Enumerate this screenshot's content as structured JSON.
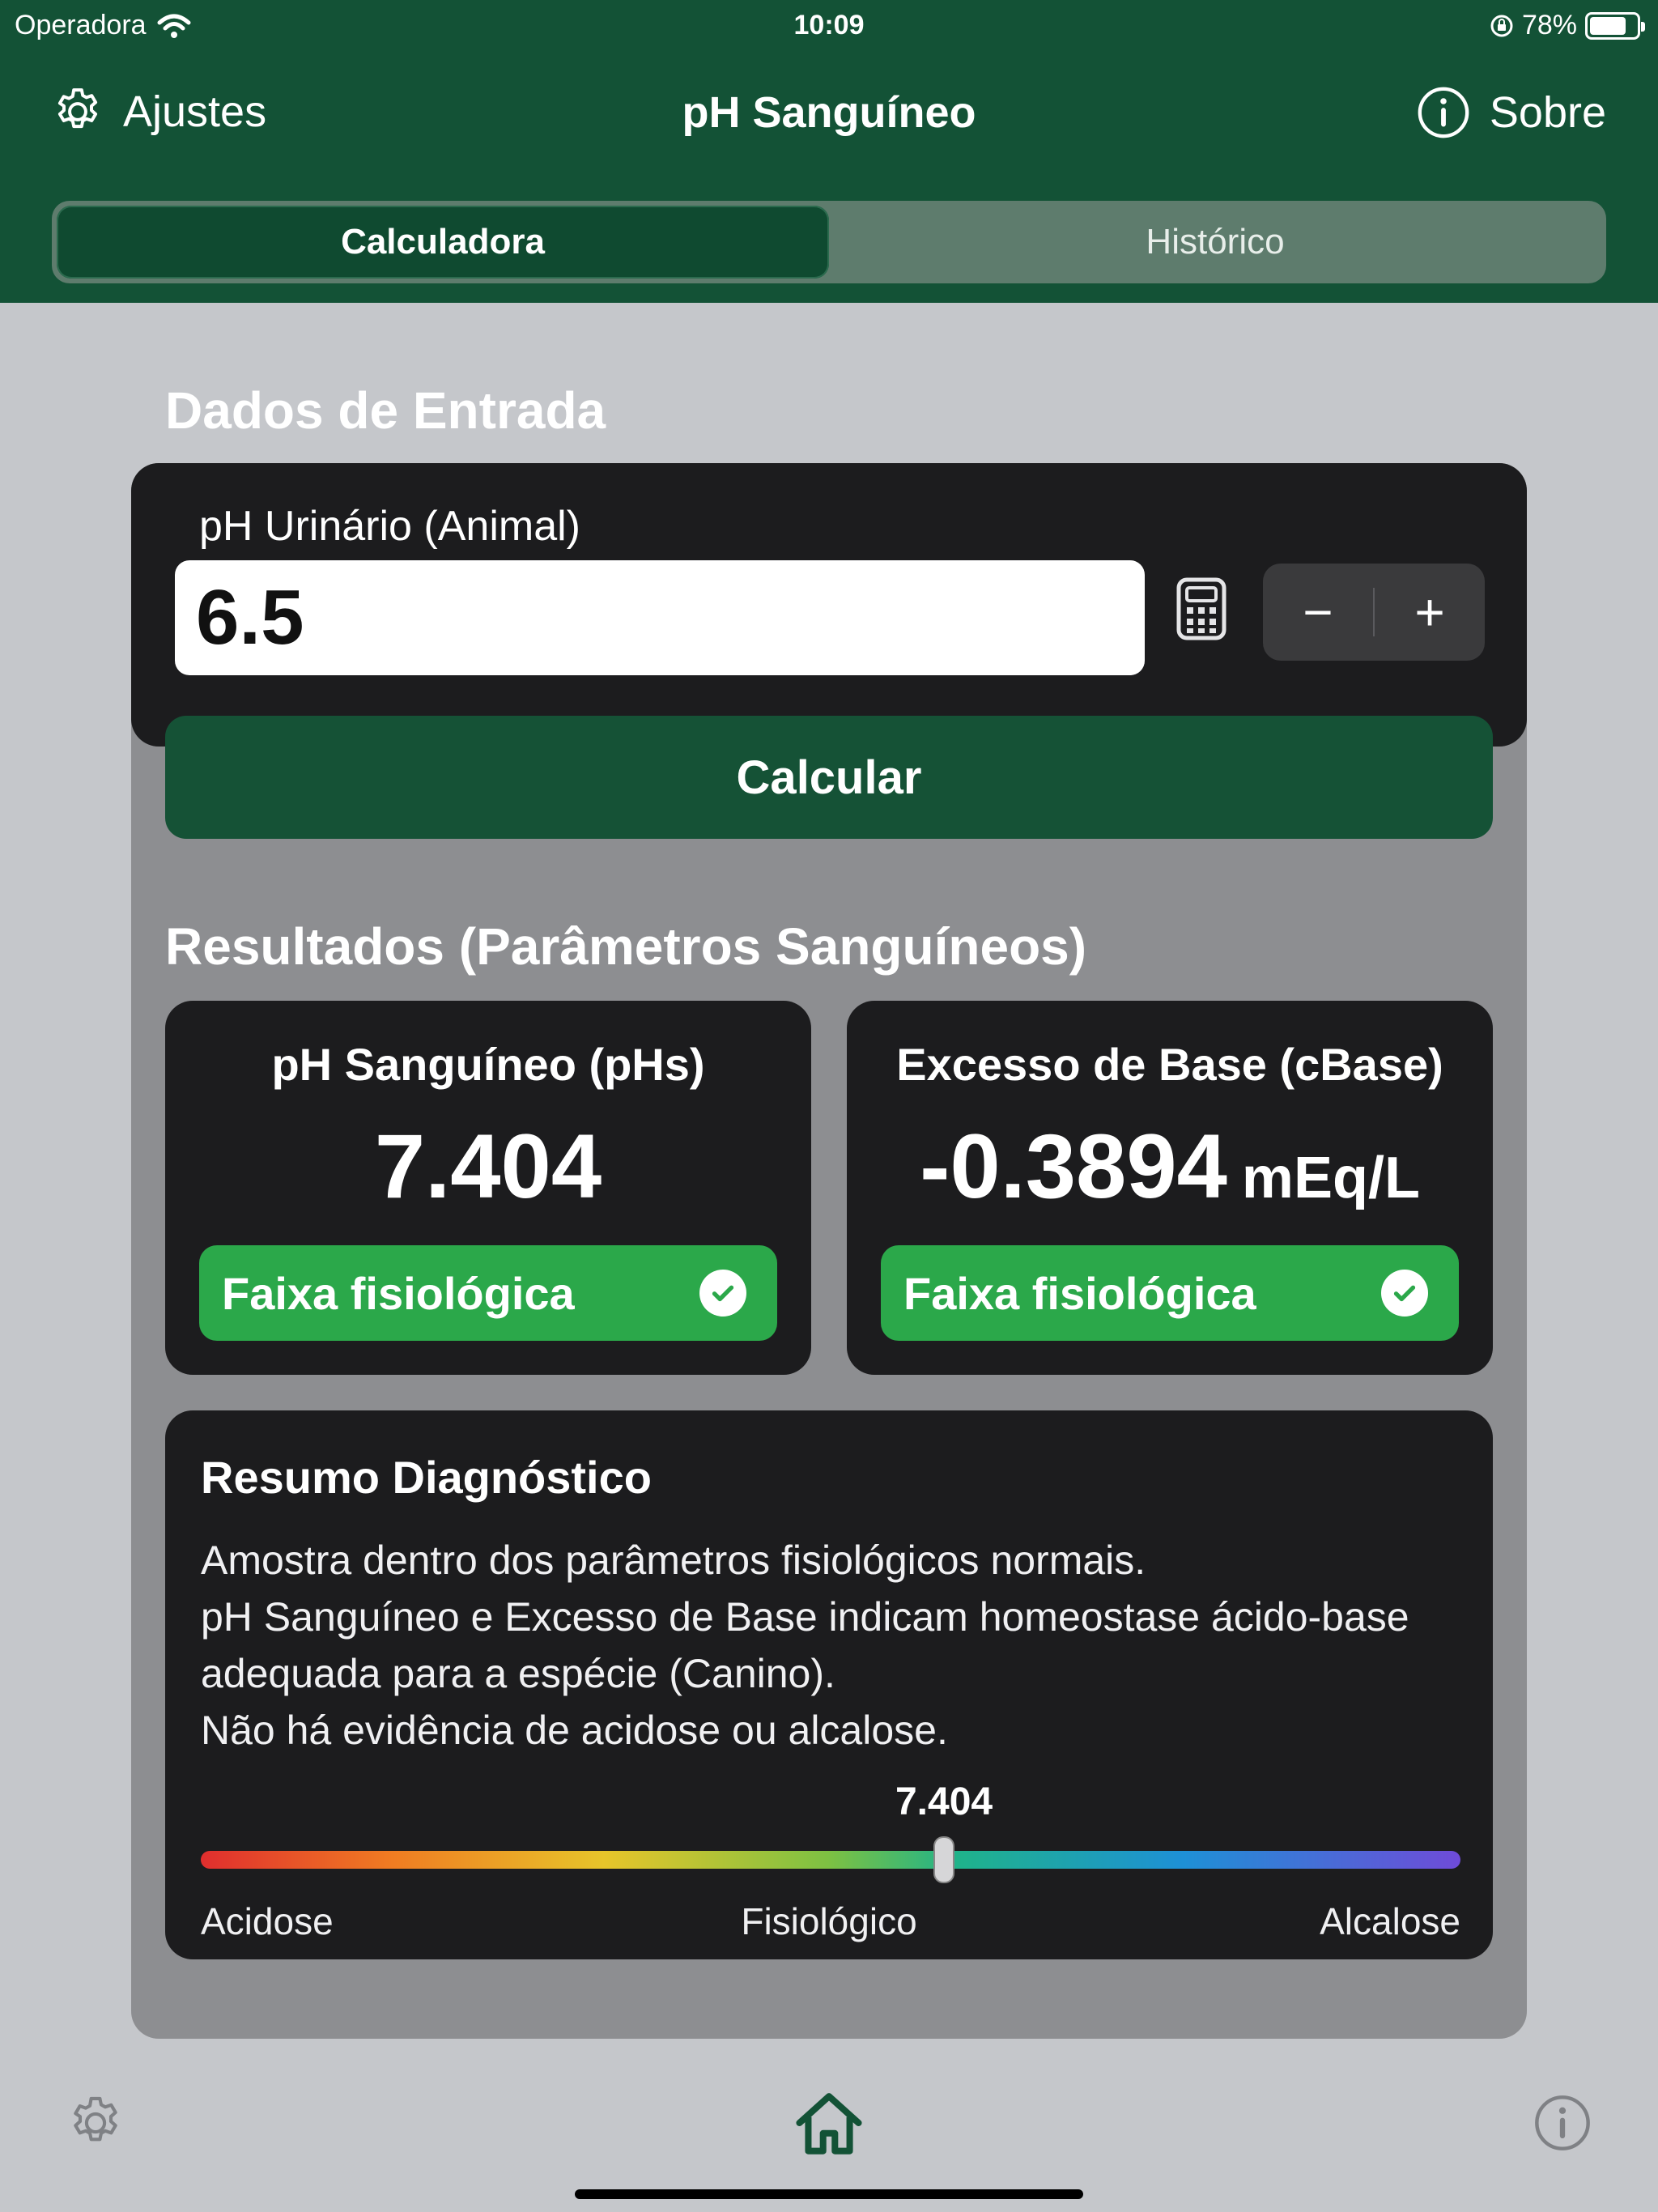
{
  "status": {
    "carrier": "Operadora",
    "time": "10:09",
    "battery": "78%",
    "battery_level": 0.78
  },
  "nav": {
    "left_label": "Ajustes",
    "title": "pH Sanguíneo",
    "right_label": "Sobre"
  },
  "tabs": [
    {
      "label": "Calculadora",
      "active": true
    },
    {
      "label": "Histórico",
      "active": false
    }
  ],
  "input_section": {
    "title": "Dados de Entrada",
    "field_label": "pH Urinário (Animal)",
    "field_value": "6.5",
    "minus": "−",
    "plus": "+",
    "calculate_label": "Calcular"
  },
  "results": {
    "title": "Resultados (Parâmetros Sanguíneos)",
    "cards": [
      {
        "title": "pH Sanguíneo (pHs)",
        "value": "7.404",
        "unit": "",
        "badge": "Faixa fisiológica"
      },
      {
        "title": "Excesso de Base (cBase)",
        "value": "-0.3894",
        "unit": "mEq/L",
        "badge": "Faixa fisiológica"
      }
    ]
  },
  "summary": {
    "title": "Resumo Diagnóstico",
    "lines": [
      "Amostra dentro dos parâmetros fisiológicos normais.",
      "pH Sanguíneo e Excesso de Base indicam homeostase ácido-base adequada para a espécie (Canino).",
      "Não há evidência de acidose ou alcalose."
    ],
    "scale": {
      "value_label": "7.404",
      "position_fraction": 0.59,
      "left_label": "Acidose",
      "center_label": "Fisiológico",
      "right_label": "Alcalose"
    }
  },
  "colors": {
    "header": "#135236",
    "accent_green": "#2ba84a",
    "card_dark": "#1c1c1e"
  },
  "icons": {
    "nav_left": "gear-icon",
    "nav_right": "info-icon",
    "bottom": [
      "gear-icon",
      "home-icon",
      "info-icon"
    ]
  }
}
